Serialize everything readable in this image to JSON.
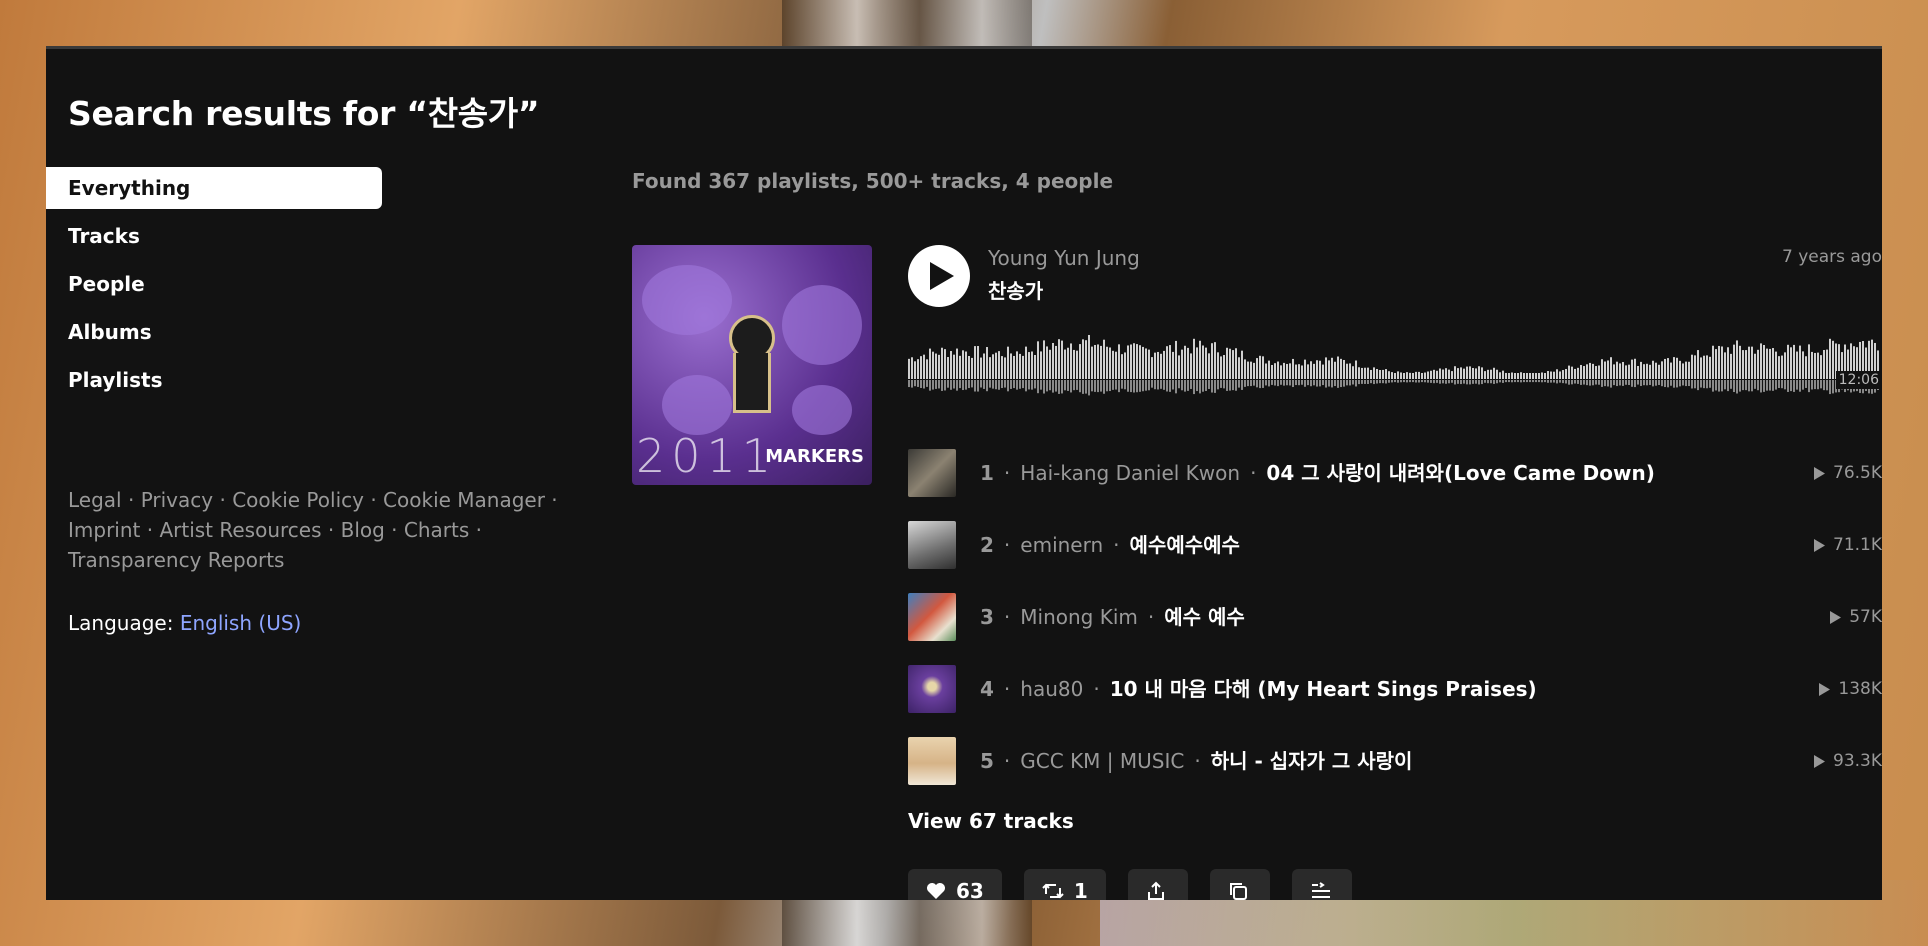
{
  "page": {
    "title": "Search results for “찬송가”"
  },
  "sidebar": {
    "items": [
      {
        "label": "Everything",
        "active": true
      },
      {
        "label": "Tracks"
      },
      {
        "label": "People"
      },
      {
        "label": "Albums"
      },
      {
        "label": "Playlists"
      }
    ],
    "footer_links": [
      "Legal",
      "Privacy",
      "Cookie Policy",
      "Cookie Manager",
      "Imprint",
      "Artist Resources",
      "Blog",
      "Charts",
      "Transparency Reports"
    ],
    "language_label": "Language:",
    "language_value": "English (US)"
  },
  "results": {
    "summary": "Found 367 playlists, 500+ tracks, 4 people",
    "playlist": {
      "uploader": "Young Yun Jung",
      "title": "찬송가",
      "posted": "7 years ago",
      "duration": "12:06",
      "artwork_text": {
        "year": "2011",
        "name": "MARKERS"
      },
      "tracks": [
        {
          "num": "1",
          "artist": "Hai-kang Daniel Kwon",
          "title": "04 그 사랑이 내려와(Love Came Down)",
          "plays": "76.5K"
        },
        {
          "num": "2",
          "artist": "eminern",
          "title": "예수예수예수",
          "plays": "71.1K"
        },
        {
          "num": "3",
          "artist": "Minong Kim",
          "title": "예수 예수",
          "plays": "57K"
        },
        {
          "num": "4",
          "artist": "hau80",
          "title": "10 내 마음 다해 (My Heart Sings Praises)",
          "plays": "138K"
        },
        {
          "num": "5",
          "artist": "GCC KM | MUSIC",
          "title": "하니 - 십자가 그 사랑이",
          "plays": "93.3K"
        }
      ],
      "view_tracks_label": "View 67 tracks",
      "actions": {
        "likes": "63",
        "reposts": "1"
      }
    }
  },
  "colors": {
    "background": "#121212",
    "text_primary": "#ffffff",
    "text_secondary": "#999999",
    "link": "#8ea5ff",
    "button_bg": "#2a2a2a"
  },
  "icons": [
    "play-icon",
    "heart-icon",
    "repost-icon",
    "share-icon",
    "copy-icon",
    "add-to-queue-icon",
    "play-count-icon"
  ]
}
